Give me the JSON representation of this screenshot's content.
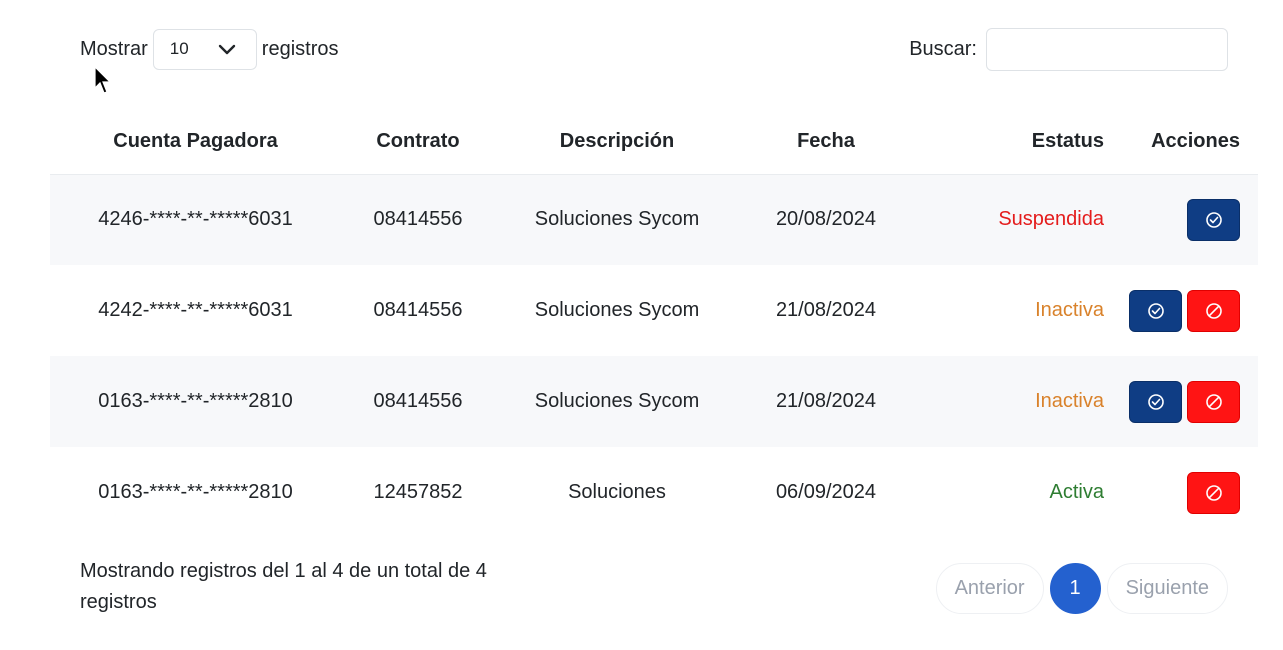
{
  "length_menu": {
    "prefix": "Mostrar",
    "value": "10",
    "suffix": "registros"
  },
  "search": {
    "label": "Buscar:",
    "value": ""
  },
  "table": {
    "headers": [
      "Cuenta Pagadora",
      "Contrato",
      "Descripción",
      "Fecha",
      "Estatus",
      "Acciones"
    ],
    "rows": [
      {
        "cuenta": "4246-****-**-*****6031",
        "contrato": "08414556",
        "descripcion": "Soluciones Sycom",
        "fecha": "20/08/2024",
        "estatus": "Suspendida"
      },
      {
        "cuenta": "4242-****-**-*****6031",
        "contrato": "08414556",
        "descripcion": "Soluciones Sycom",
        "fecha": "21/08/2024",
        "estatus": "Inactiva"
      },
      {
        "cuenta": "0163-****-**-*****2810",
        "contrato": "08414556",
        "descripcion": "Soluciones Sycom",
        "fecha": "21/08/2024",
        "estatus": "Inactiva"
      },
      {
        "cuenta": "0163-****-**-*****2810",
        "contrato": "12457852",
        "descripcion": "Soluciones",
        "fecha": "06/09/2024",
        "estatus": "Activa"
      }
    ]
  },
  "info": "Mostrando registros del 1 al 4 de un total de 4 registros",
  "pagination": {
    "prev": "Anterior",
    "current": "1",
    "next": "Siguiente"
  },
  "colors": {
    "suspendida": "#e41c1c",
    "inactiva": "#d9822b",
    "activa": "#2e7d32",
    "activate_button": "#0f3d84",
    "cancel_button": "#ff1414",
    "current_page": "#2461cf"
  },
  "icons": {
    "activate": "check-circle-icon",
    "cancel": "ban-icon",
    "select": "chevron-down-icon"
  }
}
